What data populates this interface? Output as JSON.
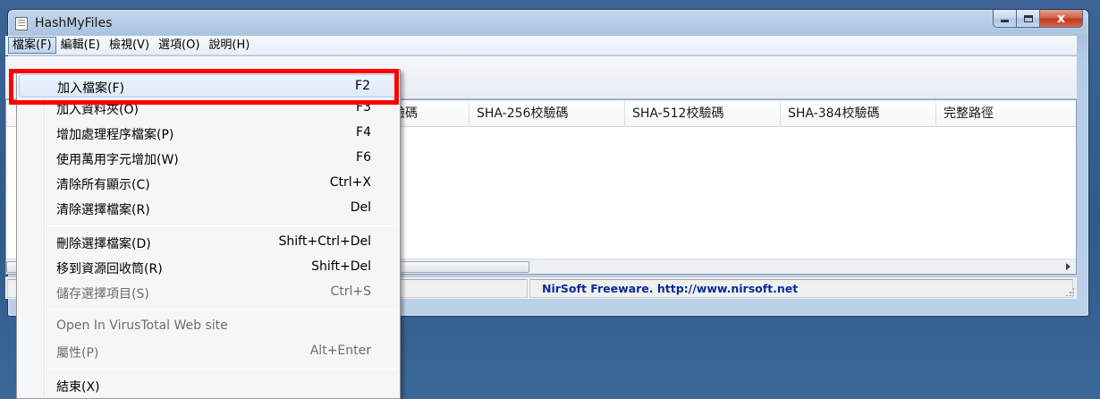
{
  "window": {
    "title": "HashMyFiles",
    "close_glyph": "x"
  },
  "menubar": {
    "items": [
      "檔案(F)",
      "編輯(E)",
      "檢視(V)",
      "選項(O)",
      "說明(H)"
    ],
    "active_index": 0
  },
  "list": {
    "columns": [
      "校驗碼",
      "SHA-256校驗碼",
      "SHA-512校驗碼",
      "SHA-384校驗碼",
      "完整路徑"
    ]
  },
  "statusbar": {
    "link_text": "NirSoft Freeware.  http://www.nirsoft.net"
  },
  "file_menu": {
    "items": [
      {
        "label": "加入檔案(F)",
        "shortcut": "F2",
        "enabled": true,
        "highlighted": true
      },
      {
        "label": "加入資料夾(O)",
        "shortcut": "F3",
        "enabled": true
      },
      {
        "label": "增加處理程序檔案(P)",
        "shortcut": "F4",
        "enabled": true
      },
      {
        "label": "使用萬用字元增加(W)",
        "shortcut": "F6",
        "enabled": true
      },
      {
        "label": "清除所有顯示(C)",
        "shortcut": "Ctrl+X",
        "enabled": true
      },
      {
        "label": "清除選擇檔案(R)",
        "shortcut": "Del",
        "enabled": true
      },
      {
        "label": "刪除選擇檔案(D)",
        "shortcut": "Shift+Ctrl+Del",
        "enabled": true
      },
      {
        "label": "移到資源回收筒(R)",
        "shortcut": "Shift+Del",
        "enabled": true
      },
      {
        "label": "儲存選擇項目(S)",
        "shortcut": "Ctrl+S",
        "enabled": false
      },
      {
        "label": "Open In VirusTotal Web site",
        "shortcut": "",
        "enabled": false
      },
      {
        "label": "屬性(P)",
        "shortcut": "Alt+Enter",
        "enabled": false
      },
      {
        "label": "結束(X)",
        "shortcut": "",
        "enabled": true
      }
    ]
  },
  "colors": {
    "annotation_box": "#ff0000",
    "status_link": "#0a2c96",
    "desktop": "#2f5a8a"
  }
}
